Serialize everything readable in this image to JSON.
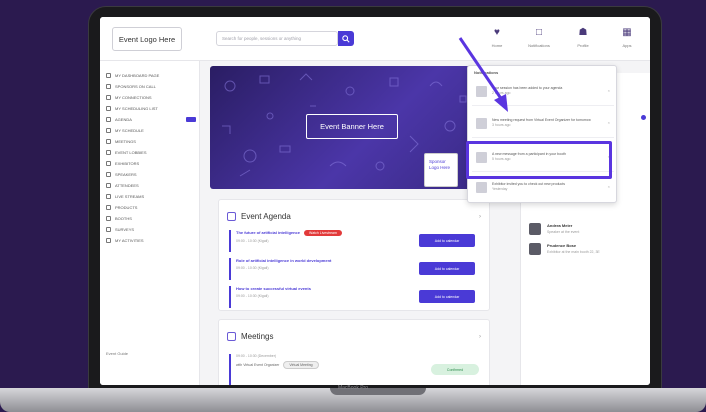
{
  "laptop_label": "MacBook Pro",
  "topbar": {
    "logo": "Event Logo Here",
    "search_placeholder": "Search for people, sessions or anything",
    "icons": [
      {
        "name": "home-icon",
        "glyph": "♥",
        "label": "Home"
      },
      {
        "name": "notifications-icon",
        "glyph": "□",
        "label": "Notifications"
      },
      {
        "name": "profile-icon",
        "glyph": "☗",
        "label": "Profile"
      },
      {
        "name": "apps-icon",
        "glyph": "▦",
        "label": "Apps"
      }
    ]
  },
  "sidebar": {
    "items": [
      "MY DASHBOARD PAGE",
      "SPONSORS ON CALL",
      "MY CONNECTIONS",
      "MY SCHEDULING LIST",
      "AGENDA",
      "MY SCHEDULE",
      "MEETINGS",
      "EVENT LOBBIES",
      "EXHIBITORS",
      "SPEAKERS",
      "ATTENDEES",
      "LIVE STREAMS",
      "PRODUCTS",
      "BOOTHS",
      "SURVEYS",
      "MY ACTIVITIES"
    ],
    "footer": "Event Guide"
  },
  "banner": {
    "title": "Event Banner Here",
    "sponsor_logo": "Sponsor Logo Here"
  },
  "agenda": {
    "title": "Event Agenda",
    "items": [
      {
        "title": "The future of artificial intelligence",
        "time": "09:00 - 10:30 (Kigali)",
        "live": "Watch Livestream",
        "button": "Add to calendar"
      },
      {
        "title": "Role of artificial intelligence in world development",
        "time": "09:00 - 10:30 (Kigali)",
        "live": "",
        "button": "Add to calendar"
      },
      {
        "title": "How to create successful virtual events",
        "time": "09:00 - 10:30 (Kigali)",
        "live": "",
        "button": "Add to calendar"
      }
    ]
  },
  "meetings": {
    "title": "Meetings",
    "item": {
      "time": "09:00 - 10:30 (December)",
      "who": "with Virtual Event Organizer",
      "chip": "Virtual Meeting",
      "status": "Confirmed"
    }
  },
  "notifications": {
    "title": "Notifications",
    "items": [
      {
        "text": "Your session has been added to your agenda",
        "sub": "2 hours ago"
      },
      {
        "text": "New meeting request from Virtual Event Organizer for tomorrow",
        "sub": "3 hours ago"
      },
      {
        "text": "A new message from a participant in your booth",
        "sub": "5 hours ago"
      },
      {
        "text": "Exhibitor invited you to check out new products",
        "sub": "Yesterday"
      }
    ]
  },
  "right_panel": {
    "people": [
      {
        "name": "Andrea Meier",
        "sub": "Speaker at the event"
      },
      {
        "name": "Prudence Bose",
        "sub": "Exhibitor at the main booth 22, 3E"
      }
    ]
  },
  "colors": {
    "accent": "#4a3ad6",
    "highlight": "#5a35e0",
    "background": "#2b1a4f"
  }
}
